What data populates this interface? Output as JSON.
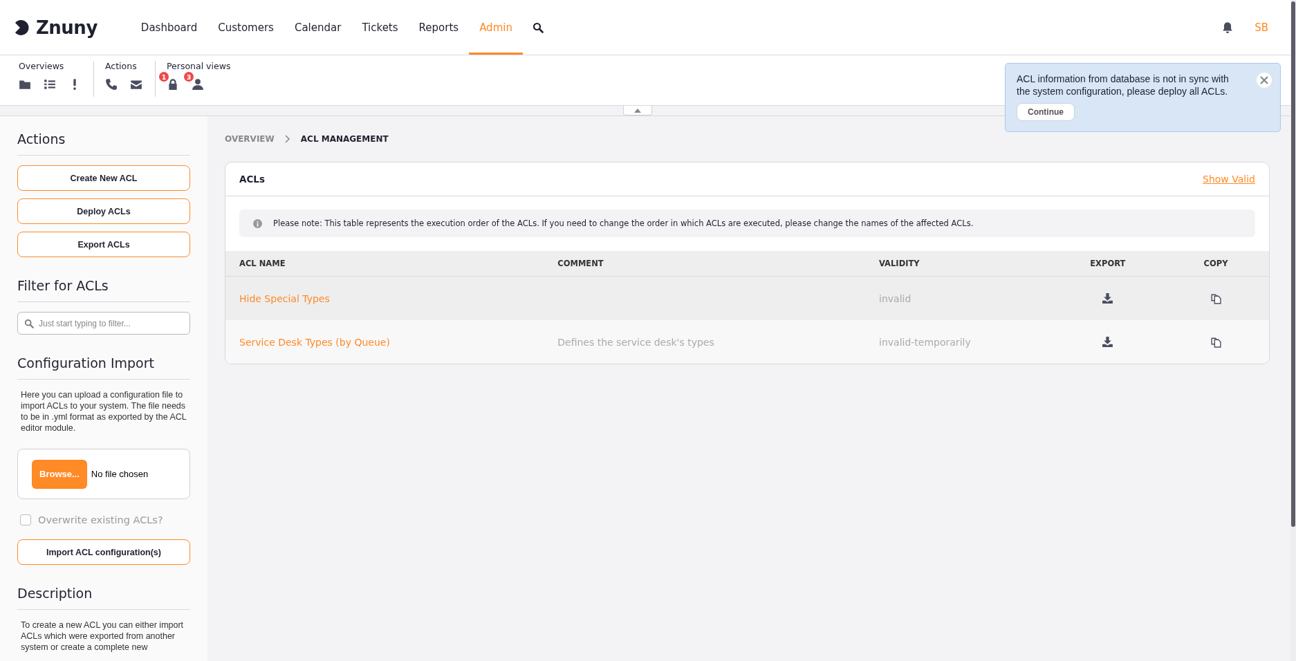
{
  "header": {
    "logo": "Znuny",
    "nav": [
      {
        "label": "Dashboard",
        "selected": false
      },
      {
        "label": "Customers",
        "selected": false
      },
      {
        "label": "Calendar",
        "selected": false
      },
      {
        "label": "Tickets",
        "selected": false
      },
      {
        "label": "Reports",
        "selected": false
      },
      {
        "label": "Admin",
        "selected": true
      }
    ],
    "user_initials": "SB"
  },
  "toolbar": {
    "groups": [
      {
        "title": "Overviews",
        "icons": [
          {
            "kind": "folder"
          },
          {
            "kind": "list"
          },
          {
            "kind": "exclamation"
          }
        ]
      },
      {
        "title": "Actions",
        "icons": [
          {
            "kind": "phone"
          },
          {
            "kind": "envelope"
          }
        ]
      },
      {
        "title": "Personal views",
        "icons": [
          {
            "kind": "lock",
            "badge": "1"
          },
          {
            "kind": "user",
            "badge": "3"
          }
        ]
      }
    ]
  },
  "notification": {
    "message": "ACL information from database is not in sync with the system configuration, please deploy all ACLs.",
    "button": "Continue"
  },
  "sidebar": {
    "actions": {
      "title": "Actions",
      "buttons": [
        "Create New ACL",
        "Deploy ACLs",
        "Export ACLs"
      ]
    },
    "filter": {
      "title": "Filter for ACLs",
      "placeholder": "Just start typing to filter..."
    },
    "import": {
      "title": "Configuration Import",
      "text": "Here you can upload a configuration file to import ACLs to your system. The file needs to be in .yml format as exported by the ACL editor module.",
      "browse": "Browse...",
      "file_status": "No file chosen",
      "overwrite": {
        "label": "Overwrite existing ACLs?",
        "checked": false
      },
      "button": "Import ACL configuration(s)"
    },
    "description": {
      "title": "Description",
      "text": "To create a new ACL you can either import ACLs which were exported from another system or create a complete new"
    }
  },
  "breadcrumb": [
    {
      "label": "OVERVIEW",
      "selected": false
    },
    {
      "label": "ACL MANAGEMENT",
      "selected": true
    }
  ],
  "panel": {
    "title": "ACLs",
    "link": "Show Valid",
    "note": "Please note: This table represents the execution order of the ACLs. If you need to change the order in which ACLs are executed, please change the names of the affected ACLs.",
    "table": {
      "columns": [
        "ACL NAME",
        "COMMENT",
        "VALIDITY",
        "EXPORT",
        "COPY"
      ],
      "rows": [
        {
          "name": "Hide Special Types",
          "validity": "invalid"
        },
        {
          "name": "Service Desk Types (by Queue)",
          "comment": "Defines the service desk's types",
          "validity": "invalid-temporarily"
        }
      ]
    }
  }
}
